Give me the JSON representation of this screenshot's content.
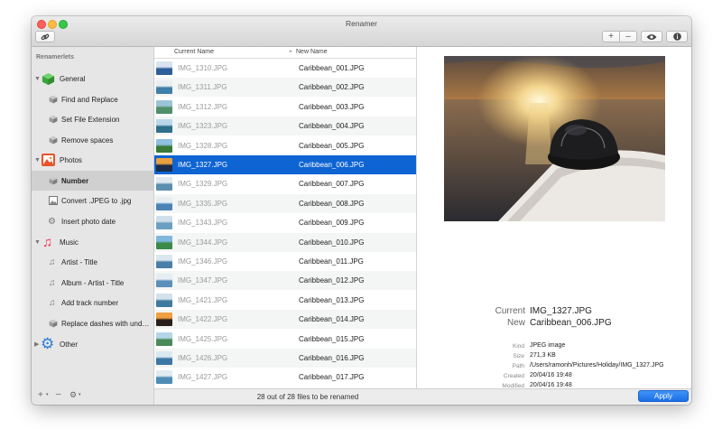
{
  "window": {
    "title": "Renamer"
  },
  "toolbar": {
    "link_icon": "link-icon",
    "add_label": "+",
    "remove_label": "–",
    "preview_icon": "eye-icon",
    "info_icon": "info-icon"
  },
  "sidebar": {
    "heading": "Renamerlets",
    "groups": [
      {
        "label": "General",
        "icon": "cube-icon"
      },
      {
        "label": "Photos",
        "icon": "photo-icon"
      },
      {
        "label": "Music",
        "icon": "music-note-icon"
      },
      {
        "label": "Other",
        "icon": "gear-icon"
      }
    ],
    "items": [
      {
        "label": "Find and Replace",
        "icon": "cube-icon"
      },
      {
        "label": "Set File Extension",
        "icon": "cube-icon"
      },
      {
        "label": "Remove spaces",
        "icon": "cube-icon"
      },
      {
        "label": "Number",
        "icon": "cube-icon"
      },
      {
        "label": "Convert .JPEG to .jpg",
        "icon": "image-icon"
      },
      {
        "label": "Insert photo date",
        "icon": "gear-icon"
      },
      {
        "label": "Artist - Title",
        "icon": "music-note-icon"
      },
      {
        "label": "Album - Artist - Title",
        "icon": "music-note-icon"
      },
      {
        "label": "Add track number",
        "icon": "music-note-icon"
      },
      {
        "label": "Replace dashes with unde...",
        "icon": "cube-icon"
      }
    ],
    "footer": {
      "add": "+",
      "remove": "–",
      "gear": "⚙"
    }
  },
  "list": {
    "col_current": "Current Name",
    "col_new": "New Name",
    "sort_indicator": "⌃",
    "rows": [
      {
        "current": "IMG_1310.JPG",
        "new": "Caribbean_001.JPG"
      },
      {
        "current": "IMG_1311.JPG",
        "new": "Caribbean_002.JPG"
      },
      {
        "current": "IMG_1312.JPG",
        "new": "Caribbean_003.JPG"
      },
      {
        "current": "IMG_1323.JPG",
        "new": "Caribbean_004.JPG"
      },
      {
        "current": "IMG_1328.JPG",
        "new": "Caribbean_005.JPG"
      },
      {
        "current": "IMG_1327.JPG",
        "new": "Caribbean_006.JPG"
      },
      {
        "current": "IMG_1329.JPG",
        "new": "Caribbean_007.JPG"
      },
      {
        "current": "IMG_1335.JPG",
        "new": "Caribbean_008.JPG"
      },
      {
        "current": "IMG_1343.JPG",
        "new": "Caribbean_009.JPG"
      },
      {
        "current": "IMG_1344.JPG",
        "new": "Caribbean_010.JPG"
      },
      {
        "current": "IMG_1346.JPG",
        "new": "Caribbean_011.JPG"
      },
      {
        "current": "IMG_1347.JPG",
        "new": "Caribbean_012.JPG"
      },
      {
        "current": "IMG_1421.JPG",
        "new": "Caribbean_013.JPG"
      },
      {
        "current": "IMG_1422.JPG",
        "new": "Caribbean_014.JPG"
      },
      {
        "current": "IMG_1425.JPG",
        "new": "Caribbean_015.JPG"
      },
      {
        "current": "IMG_1426.JPG",
        "new": "Caribbean_016.JPG"
      },
      {
        "current": "IMG_1427.JPG",
        "new": "Caribbean_017.JPG"
      }
    ],
    "selected_index": 5
  },
  "preview": {
    "current_label": "Current",
    "current_value": "IMG_1327.JPG",
    "new_label": "New",
    "new_value": "Caribbean_006.JPG",
    "details": [
      {
        "key": "Kind",
        "value": "JPEG image"
      },
      {
        "key": "Size",
        "value": "271,3 KB"
      },
      {
        "key": "Path",
        "value": "/Users/ramonh/Pictures/Holiday/IMG_1327.JPG"
      },
      {
        "key": "Created",
        "value": "20/04/16 19:48"
      },
      {
        "key": "Modified",
        "value": "20/04/16 19:48"
      }
    ]
  },
  "status": {
    "text": "28 out of 28 files to be renamed",
    "apply_label": "Apply"
  },
  "colors": {
    "selection": "#0e64d2",
    "apply": "#1b6fe6"
  }
}
